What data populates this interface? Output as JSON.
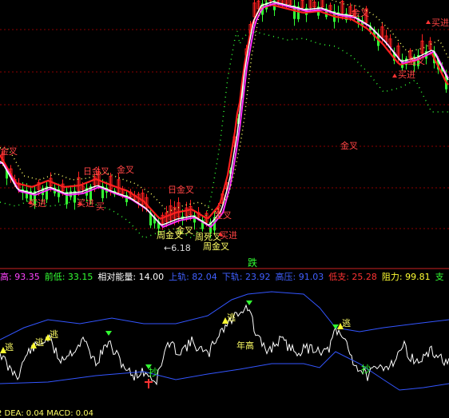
{
  "chart_data": [
    {
      "type": "line",
      "panel": "main",
      "grid": true,
      "series": [
        {
          "name": "",
          "color": "#ffffff",
          "role": "price-ma"
        },
        {
          "name": "",
          "color": "#ff33ff",
          "role": "fast-ma"
        },
        {
          "name": "",
          "color": "#ff2020",
          "role": "slow-ma"
        },
        {
          "name": "",
          "color": "#ffff66",
          "role": "dots"
        },
        {
          "name": "",
          "color": "#33ff33",
          "role": "dots"
        }
      ],
      "annotations": {
        "buy": "买进",
        "buy_partial": "买",
        "day_golden_cross": "日金叉",
        "week_golden_cross": "周金叉",
        "golden_cross": "金叉",
        "week_death_cross": "周死叉",
        "low_price": "←6.18",
        "fall": "跌"
      }
    },
    {
      "type": "line",
      "panel": "indicator",
      "grid": false,
      "header": [
        {
          "label": "高:",
          "value": "93.35",
          "color": "#ff44ff"
        },
        {
          "label": "前低:",
          "value": "33.15",
          "color": "#33ff33"
        },
        {
          "label": "相对能量:",
          "value": "14.00",
          "color": "#ffffff"
        },
        {
          "label": "上轨:",
          "value": "82.04",
          "color": "#4060ff"
        },
        {
          "label": "下轨:",
          "value": "23.92",
          "color": "#4060ff"
        },
        {
          "label": "高压:",
          "value": "91.03",
          "color": "#4060ff"
        },
        {
          "label": "低支:",
          "value": "25.28",
          "color": "#ff3333"
        },
        {
          "label": "阻力:",
          "value": "99.81",
          "color": "#ffff33"
        },
        {
          "label": "支",
          "value": "",
          "color": "#33ff33"
        }
      ],
      "annotations": {
        "escape": "逃",
        "year_high": "年高",
        "copy_bottom": "抄"
      },
      "series": [
        {
          "name": "",
          "color": "#ffffff",
          "role": "energy"
        },
        {
          "name": "",
          "color": "#3355ff",
          "role": "upper"
        },
        {
          "name": "",
          "color": "#3355ff",
          "role": "lower"
        }
      ]
    }
  ],
  "footer": {
    "text": "2 DEA: 0.04  MACD: 0.04"
  },
  "colors": {
    "up": "#ff2020",
    "down": "#33ff33",
    "grid": "#8b0000",
    "bg": "#000000"
  }
}
